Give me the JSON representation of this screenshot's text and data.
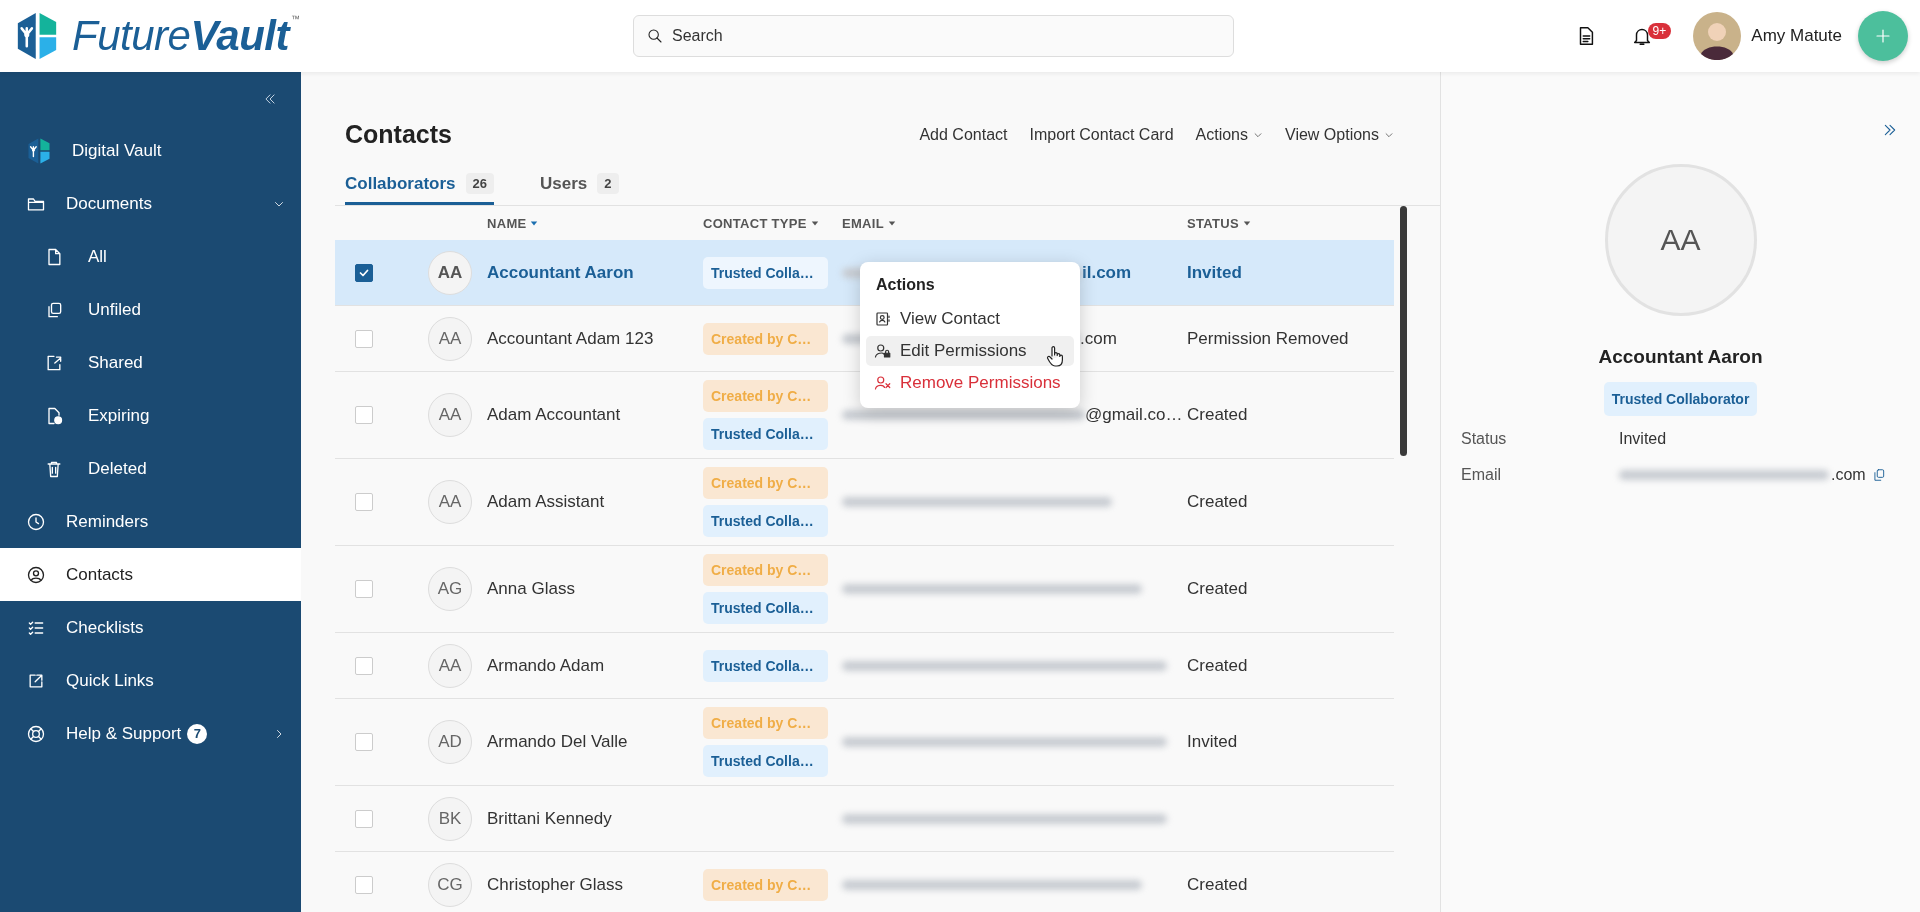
{
  "header": {
    "brand": "Future**Vault**",
    "trademark": "™",
    "search": {
      "placeholder": "Search"
    },
    "notifications": {
      "badge": "9+"
    },
    "user": {
      "name": "Amy Matute"
    }
  },
  "sidebar": {
    "items": [
      {
        "label": "Digital Vault",
        "kind": "vault",
        "selected": false
      },
      {
        "label": "Documents",
        "kind": "folder",
        "selected": false,
        "expanded": true,
        "children": [
          {
            "label": "All",
            "kind": "file",
            "selected": false
          },
          {
            "label": "Unfiled",
            "kind": "copies",
            "selected": false
          },
          {
            "label": "Shared",
            "kind": "share",
            "selected": false
          },
          {
            "label": "Expiring",
            "kind": "expiring",
            "selected": false
          },
          {
            "label": "Deleted",
            "kind": "trash",
            "selected": false
          }
        ]
      },
      {
        "label": "Reminders",
        "kind": "clock",
        "selected": false
      },
      {
        "label": "Contacts",
        "kind": "contact",
        "selected": true
      },
      {
        "label": "Checklists",
        "kind": "checklist",
        "selected": false
      },
      {
        "label": "Quick Links",
        "kind": "link",
        "selected": false
      },
      {
        "label": "Help & Support",
        "kind": "help",
        "selected": false,
        "badge": "7",
        "expanded": false
      }
    ]
  },
  "page": {
    "title": "Contacts",
    "actions": [
      {
        "label": "Add Contact",
        "dropdown": false
      },
      {
        "label": "Import Contact Card",
        "dropdown": false
      },
      {
        "label": "Actions",
        "dropdown": true
      },
      {
        "label": "View Options",
        "dropdown": true
      }
    ],
    "tabs": [
      {
        "label": "Collaborators",
        "count": "26",
        "selected": true
      },
      {
        "label": "Users",
        "count": "2",
        "selected": false
      }
    ]
  },
  "table": {
    "columns": [
      {
        "label": "NAME",
        "sorted": true
      },
      {
        "label": "CONTACT TYPE",
        "sorted": false
      },
      {
        "label": "EMAIL",
        "sorted": false
      },
      {
        "label": "STATUS",
        "sorted": false
      }
    ],
    "rows": [
      {
        "initials": "AA",
        "name": "Accountant Aaron",
        "types": [
          {
            "kind": "trusted",
            "label": "Trusted Colla…"
          }
        ],
        "email": "il.com",
        "status": "Invited",
        "checked": true,
        "selected": true
      },
      {
        "initials": "AA",
        "name": "Accountant Adam 123",
        "types": [
          {
            "kind": "created",
            "label": "Created by C…"
          }
        ],
        "email": ".com",
        "status": "Permission Removed",
        "checked": false,
        "selected": false
      },
      {
        "initials": "AA",
        "name": "Adam Accountant",
        "types": [
          {
            "kind": "created",
            "label": "Created by C…"
          },
          {
            "kind": "trusted",
            "label": "Trusted Colla…"
          }
        ],
        "email": "@gmail.co…",
        "status": "Created",
        "checked": false,
        "selected": false
      },
      {
        "initials": "AA",
        "name": "Adam Assistant",
        "types": [
          {
            "kind": "created",
            "label": "Created by C…"
          },
          {
            "kind": "trusted",
            "label": "Trusted Colla…"
          }
        ],
        "status": "Created",
        "checked": false,
        "selected": false
      },
      {
        "initials": "AG",
        "name": "Anna Glass",
        "types": [
          {
            "kind": "created",
            "label": "Created by C…"
          },
          {
            "kind": "trusted",
            "label": "Trusted Colla…"
          }
        ],
        "status": "Created",
        "checked": false,
        "selected": false
      },
      {
        "initials": "AA",
        "name": "Armando Adam",
        "types": [
          {
            "kind": "trusted",
            "label": "Trusted Colla…"
          }
        ],
        "status": "Created",
        "checked": false,
        "selected": false
      },
      {
        "initials": "AD",
        "name": "Armando Del Valle",
        "types": [
          {
            "kind": "created",
            "label": "Created by C…"
          },
          {
            "kind": "trusted",
            "label": "Trusted Colla…"
          }
        ],
        "status": "Invited",
        "checked": false,
        "selected": false
      },
      {
        "initials": "BK",
        "name": "Brittani Kennedy",
        "types": [],
        "checked": false,
        "selected": false
      },
      {
        "initials": "CG",
        "name": "Christopher Glass",
        "types": [
          {
            "kind": "created",
            "label": "Created by C…"
          }
        ],
        "status": "Created",
        "checked": false,
        "selected": false
      }
    ]
  },
  "context_menu": {
    "title": "Actions",
    "items": [
      {
        "label": "View Contact",
        "kind": "view",
        "danger": false,
        "selected": false
      },
      {
        "label": "Edit Permissions",
        "kind": "edit",
        "danger": false,
        "selected": true
      },
      {
        "label": "Remove Permissions",
        "kind": "remove",
        "danger": true,
        "selected": false
      }
    ]
  },
  "details": {
    "initials": "AA",
    "name": "Accountant Aaron",
    "type": {
      "kind": "trusted",
      "label": "Trusted Collaborator"
    },
    "fields": [
      {
        "label": "Status",
        "value": "Invited"
      },
      {
        "label": "Email",
        "value": ".com",
        "blurred": true
      }
    ]
  }
}
